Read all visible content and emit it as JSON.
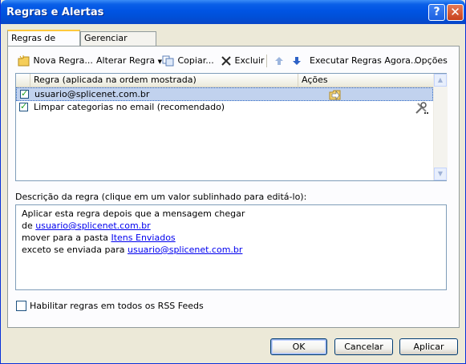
{
  "window": {
    "title": "Regras e Alertas",
    "help_label": "?",
    "close_label": "✕"
  },
  "tabs": [
    {
      "label": "Regras de Email",
      "active": true
    },
    {
      "label": "Gerenciar Alertas",
      "active": false
    }
  ],
  "toolbar": {
    "new_rule": "Nova Regra...",
    "change_rule": "Alterar Regra",
    "copy": "Copiar...",
    "delete": "Excluir",
    "run_rules": "Executar Regras Agora...",
    "options": "Opções"
  },
  "rules_list": {
    "col_rule": "Regra (aplicada na ordem mostrada)",
    "col_actions": "Ações",
    "rows": [
      {
        "label": "usuario@splicenet.com.br",
        "checked": true,
        "selected": true,
        "action_icon": "move-to-folder-icon"
      },
      {
        "label": "Limpar categorias no email (recomendado)",
        "checked": true,
        "selected": false,
        "action_icon": "tools-icon"
      }
    ]
  },
  "description": {
    "label": "Descrição da regra (clique em um valor sublinhado para editá-lo):",
    "line1": "Aplicar esta regra depois que a mensagem chegar",
    "line2_prefix": "de ",
    "line2_link": "usuario@splicenet.com.br",
    "line3_prefix": "mover para a pasta ",
    "line3_link": "Itens Enviados",
    "line4_prefix": "exceto se enviada para ",
    "line4_link": "usuario@splicenet.com.br"
  },
  "rss": {
    "label": "Habilitar regras em todos os RSS Feeds",
    "checked": false
  },
  "buttons": {
    "ok": "OK",
    "cancel": "Cancelar",
    "apply": "Aplicar"
  }
}
